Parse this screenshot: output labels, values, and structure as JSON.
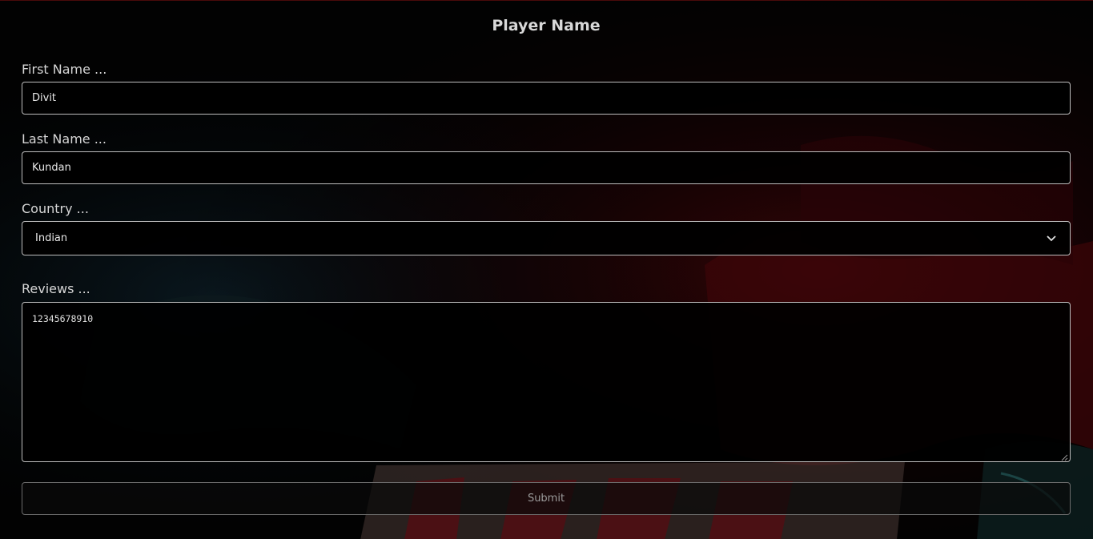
{
  "form": {
    "title": "Player Name",
    "first_name": {
      "label": "First Name ...",
      "value": "Divit"
    },
    "last_name": {
      "label": "Last Name ...",
      "value": "Kundan"
    },
    "country": {
      "label": "Country ...",
      "selected": "Indian"
    },
    "reviews": {
      "label": "Reviews ...",
      "value": "12345678910"
    },
    "submit_label": "Submit"
  },
  "icons": {
    "select_arrow": "chevron-down-icon",
    "textarea_resize": "resize-grip-icon"
  },
  "colors": {
    "background": "#000000",
    "text": "#d8d8d8",
    "border": "#bdbdbd",
    "submit_text": "#9b9b9b"
  }
}
